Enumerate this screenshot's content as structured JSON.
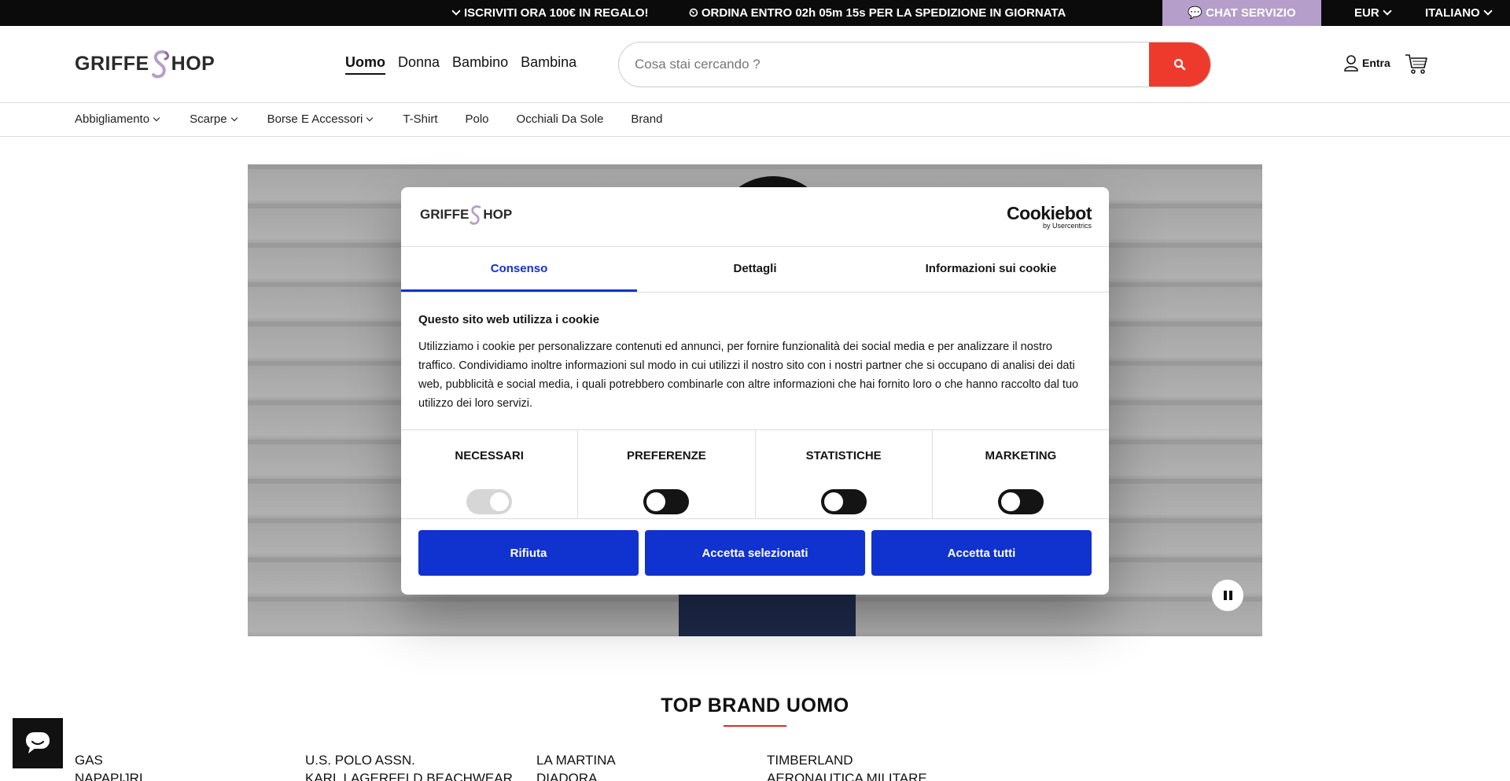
{
  "topbar": {
    "promo_signup": "ISCRIVITI ORA 100€ IN REGALO!",
    "promo_shipping_prefix": "ORDINA ENTRO",
    "promo_shipping_time": "02h 05m 15s",
    "promo_shipping_suffix": "PER LA SPEDIZIONE IN GIORNATA",
    "chat_label": "CHAT SERVIZIO CLIENTI!",
    "currency": "EUR",
    "language": "ITALIANO"
  },
  "header": {
    "logo_left": "GRIFFE",
    "logo_right": "HOP",
    "nav": [
      "Uomo",
      "Donna",
      "Bambino",
      "Bambina"
    ],
    "search_placeholder": "Cosa stai cercando ?",
    "login_label": "Entra"
  },
  "categories": [
    {
      "label": "Abbigliamento",
      "dropdown": true
    },
    {
      "label": "Scarpe",
      "dropdown": true
    },
    {
      "label": "Borse E Accessori",
      "dropdown": true
    },
    {
      "label": "T-Shirt",
      "dropdown": false
    },
    {
      "label": "Polo",
      "dropdown": false
    },
    {
      "label": "Occhiali Da Sole",
      "dropdown": false
    },
    {
      "label": "Brand",
      "dropdown": false
    }
  ],
  "brands": {
    "title": "TOP BRAND UOMO",
    "columns": [
      [
        "GAS",
        "NAPAPIJRI"
      ],
      [
        "U.S. POLO ASSN.",
        "KARL LAGERFELD BEACHWEAR"
      ],
      [
        "LA MARTINA",
        "DIADORA"
      ],
      [
        "TIMBERLAND",
        "AERONAUTICA MILITARE"
      ]
    ]
  },
  "cookie": {
    "logo_left": "GRIFFE",
    "logo_right": "HOP",
    "provider": "Cookiebot",
    "provider_sub": "by Usercentrics",
    "tabs": [
      "Consenso",
      "Dettagli",
      "Informazioni sui cookie"
    ],
    "heading": "Questo sito web utilizza i cookie",
    "body": "Utilizziamo i cookie per personalizzare contenuti ed annunci, per fornire funzionalità dei social media e per analizzare il nostro traffico. Condividiamo inoltre informazioni sul modo in cui utilizzi il nostro sito con i nostri partner che si occupano di analisi dei dati web, pubblicità e social media, i quali potrebbero combinarle con altre informazioni che hai fornito loro o che hanno raccolto dal tuo utilizzo dei loro servizi.",
    "toggles": [
      {
        "label": "NECESSARI",
        "on": true,
        "disabled": true
      },
      {
        "label": "PREFERENZE",
        "on": false,
        "disabled": false
      },
      {
        "label": "STATISTICHE",
        "on": false,
        "disabled": false
      },
      {
        "label": "MARKETING",
        "on": false,
        "disabled": false
      }
    ],
    "buttons": [
      "Rifiuta",
      "Accetta selezionati",
      "Accetta tutti"
    ]
  },
  "colors": {
    "accent_red": "#ee3a2d",
    "cookie_blue": "#1032cf",
    "chat_purple": "#b59ec9"
  }
}
